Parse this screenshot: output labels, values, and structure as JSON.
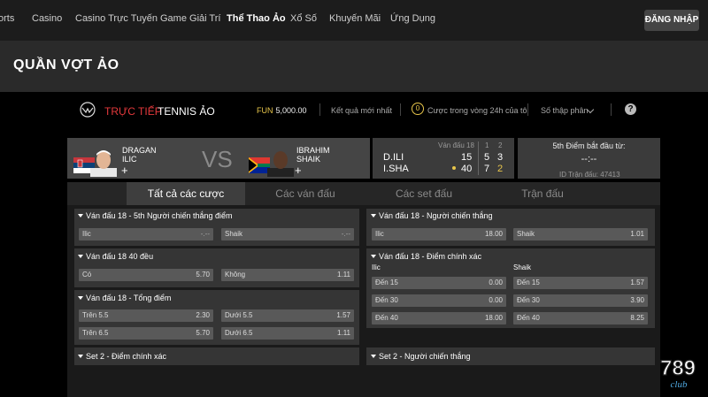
{
  "nav": {
    "items": [
      "orts",
      "Casino",
      "Casino Trực Tuyến",
      "Game Giải Trí",
      "Thể Thao Ảo",
      "Xổ Số",
      "Khuyến Mãi",
      "Ứng Dụng"
    ],
    "active_index": 4,
    "login_label": "ĐĂNG NHẬP"
  },
  "page_title": "QUẦN VỢT ẢO",
  "tennis_header": {
    "live_label": "TRỰC TIẾP",
    "brand_label": "TENNIS ẢO",
    "fun_label": "FUN",
    "fun_balance": "5,000.00",
    "latest_results_label": "Kết quả mới nhất",
    "bets_count": "0",
    "bets_label": "Cược trong vòng 24h của tôi",
    "odds_format_label": "Số thập phân",
    "help_label": "?"
  },
  "match": {
    "player1": {
      "first": "DRAGAN",
      "last": "ILIC",
      "flag": "serbia-flag"
    },
    "player2": {
      "first": "IBRAHIM",
      "last": "SHAIK",
      "flag": "south-africa-flag"
    },
    "vs_label": "VS",
    "plus_label": "+"
  },
  "scoreboard": {
    "game_label": "Ván đấu 18",
    "set_headers": [
      "1",
      "2"
    ],
    "rows": [
      {
        "name": "D.ILI",
        "points": "15",
        "set1": "5",
        "set2": "3"
      },
      {
        "name": "I.SHA",
        "points": "40",
        "set1": "7",
        "set2": "2"
      }
    ],
    "serving": "I.SHA"
  },
  "info": {
    "title": "5th Điểm bắt đầu từ:",
    "time": "--:--",
    "match_id_label": "ID Trận đấu:",
    "match_id": "47413"
  },
  "tabs": [
    "Tất cả các cược",
    "Các ván đấu",
    "Các set đấu",
    "Trận đấu"
  ],
  "active_tab": 0,
  "markets": {
    "m1": {
      "title": "Ván đấu 18 - 5th Người chiến thắng điểm",
      "odds": [
        {
          "label": "Ilic",
          "value": "-.--"
        },
        {
          "label": "Shaik",
          "value": "-.--"
        }
      ]
    },
    "m2": {
      "title": "Ván đấu 18 40 đều",
      "odds": [
        {
          "label": "Có",
          "value": "5.70"
        },
        {
          "label": "Không",
          "value": "1.11"
        }
      ]
    },
    "m3": {
      "title": "Ván đấu 18 - Tổng điểm",
      "odds": [
        {
          "label": "Trên 5.5",
          "value": "2.30"
        },
        {
          "label": "Dưới 5.5",
          "value": "1.57"
        },
        {
          "label": "Trên 6.5",
          "value": "5.70"
        },
        {
          "label": "Dưới 6.5",
          "value": "1.11"
        }
      ]
    },
    "m4": {
      "title": "Set 2 - Điểm chính xác"
    },
    "m5": {
      "title": "Ván đấu 18 - Người chiến thắng",
      "odds": [
        {
          "label": "Ilic",
          "value": "18.00"
        },
        {
          "label": "Shaik",
          "value": "1.01"
        }
      ]
    },
    "m6": {
      "title": "Ván đấu 18 - Điểm chính xác",
      "col_left": "Ilic",
      "col_right": "Shaik",
      "odds": [
        {
          "label": "Đến 15",
          "value": "0.00"
        },
        {
          "label": "Đến 15",
          "value": "1.57"
        },
        {
          "label": "Đến 30",
          "value": "0.00"
        },
        {
          "label": "Đến 30",
          "value": "3.90"
        },
        {
          "label": "Đến 40",
          "value": "18.00"
        },
        {
          "label": "Đến 40",
          "value": "8.25"
        }
      ]
    },
    "m7": {
      "title": "Set 2 - Người chiến thắng"
    }
  },
  "badge": {
    "number": "789",
    "word": "club"
  },
  "colors": {
    "live_red": "#e3393c",
    "accent_yellow": "#e8c64b"
  }
}
